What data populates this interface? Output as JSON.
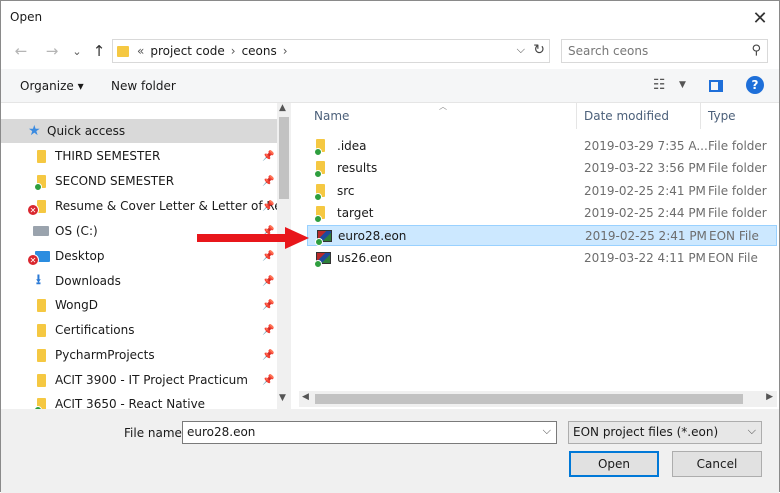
{
  "window": {
    "title": "Open",
    "close_glyph": "✕"
  },
  "nav": {
    "back_icon": "arrow-left-icon",
    "forward_icon": "arrow-right-icon",
    "up_icon": "arrow-up-icon"
  },
  "address": {
    "overflow": "«",
    "segments": [
      "project code",
      "ceons"
    ]
  },
  "search": {
    "placeholder": "Search ceons"
  },
  "toolbar": {
    "organize": "Organize ▾",
    "new_folder": "New folder",
    "help": "?"
  },
  "sidebar": {
    "items": [
      {
        "label": "Quick access",
        "icon": "star-icon"
      },
      {
        "label": "THIRD SEMESTER",
        "icon": "folder-icon"
      },
      {
        "label": "SECOND SEMESTER",
        "icon": "folder-icon"
      },
      {
        "label": "Resume & Cover Letter & Letter of Re",
        "icon": "folder-icon"
      },
      {
        "label": "OS (C:)",
        "icon": "drive-icon"
      },
      {
        "label": "Desktop",
        "icon": "desktop-icon"
      },
      {
        "label": "Downloads",
        "icon": "download-icon"
      },
      {
        "label": "WongD",
        "icon": "folder-icon"
      },
      {
        "label": "Certifications",
        "icon": "folder-icon"
      },
      {
        "label": "PycharmProjects",
        "icon": "folder-icon"
      },
      {
        "label": "ACIT 3900 - IT Project Practicum",
        "icon": "folder-icon"
      },
      {
        "label": "ACIT 3650 - React Native",
        "icon": "folder-icon"
      }
    ]
  },
  "columns": {
    "name": "Name",
    "date": "Date modified",
    "type": "Type"
  },
  "files": [
    {
      "name": ".idea",
      "date": "2019-03-29 7:35 A...",
      "type": "File folder",
      "icon": "folder-icon"
    },
    {
      "name": "results",
      "date": "2019-03-22 3:56 PM",
      "type": "File folder",
      "icon": "folder-icon"
    },
    {
      "name": "src",
      "date": "2019-02-25 2:41 PM",
      "type": "File folder",
      "icon": "folder-icon"
    },
    {
      "name": "target",
      "date": "2019-02-25 2:44 PM",
      "type": "File folder",
      "icon": "folder-icon"
    },
    {
      "name": "euro28.eon",
      "date": "2019-02-25 2:41 PM",
      "type": "EON File",
      "icon": "eon-file-icon"
    },
    {
      "name": "us26.eon",
      "date": "2019-03-22 4:11 PM",
      "type": "EON File",
      "icon": "eon-file-icon"
    }
  ],
  "bottom": {
    "filename_label": "File name:",
    "filename_value": "euro28.eon",
    "filter": "EON project files (*.eon)",
    "open": "Open",
    "cancel": "Cancel"
  },
  "colors": {
    "selection": "#cce8ff",
    "accent": "#0078d7",
    "annotation_arrow": "#e8161b"
  }
}
